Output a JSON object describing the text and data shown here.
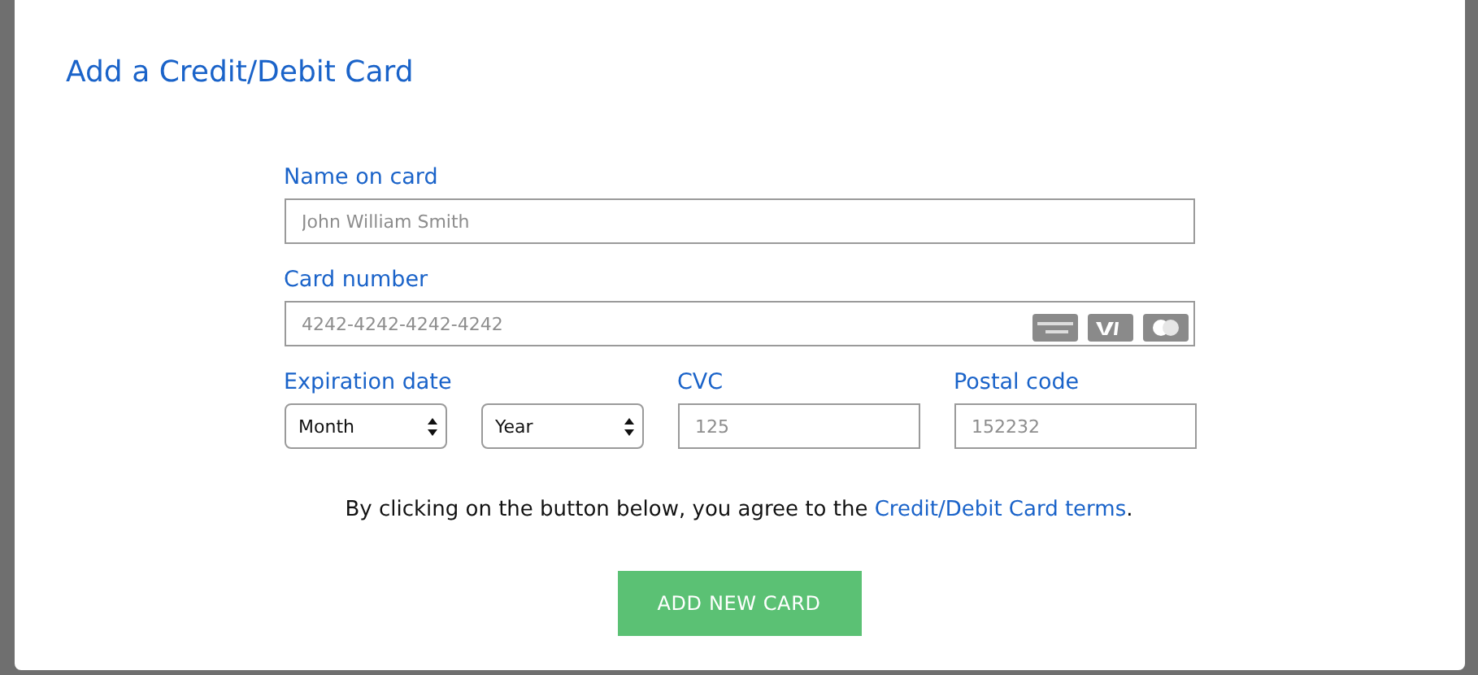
{
  "dialog": {
    "title": "Add a Credit/Debit Card"
  },
  "fields": {
    "name": {
      "label": "Name on card",
      "placeholder": "John William Smith"
    },
    "card_number": {
      "label": "Card number",
      "placeholder": "4242-4242-4242-4242"
    },
    "expiration": {
      "label": "Expiration date",
      "month": "Month",
      "year": "Year"
    },
    "cvc": {
      "label": "CVC",
      "placeholder": "125"
    },
    "postal": {
      "label": "Postal code",
      "placeholder": "152232"
    }
  },
  "terms": {
    "text": "By clicking on the button below, you agree to the",
    "link": "Credit/Debit Card terms",
    "end": "."
  },
  "submit": {
    "label": "ADD NEW CARD"
  }
}
